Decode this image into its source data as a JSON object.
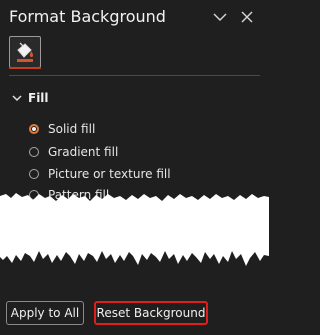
{
  "pane": {
    "title": "Format Background",
    "collapse_icon": "chevron-down-icon",
    "close_icon": "close-icon"
  },
  "tabs": [
    {
      "icon": "paint-bucket-icon",
      "name": "Fill",
      "selected": true
    }
  ],
  "section": {
    "label": "Fill",
    "icon": "chevron-down-icon",
    "expanded": true
  },
  "fill_options": [
    {
      "label": "Solid fill",
      "selected": true
    },
    {
      "label": "Gradient fill",
      "selected": false
    },
    {
      "label": "Picture or texture fill",
      "selected": false
    },
    {
      "label": "Pattern fill",
      "selected": false
    }
  ],
  "buttons": {
    "apply_all": "Apply to All",
    "reset_background": "Reset Background"
  },
  "colors": {
    "background": "#1f1f1f",
    "accent": "#c43e1c",
    "radio_selected": "#e07a3c",
    "highlight_box": "#e01e1e"
  }
}
